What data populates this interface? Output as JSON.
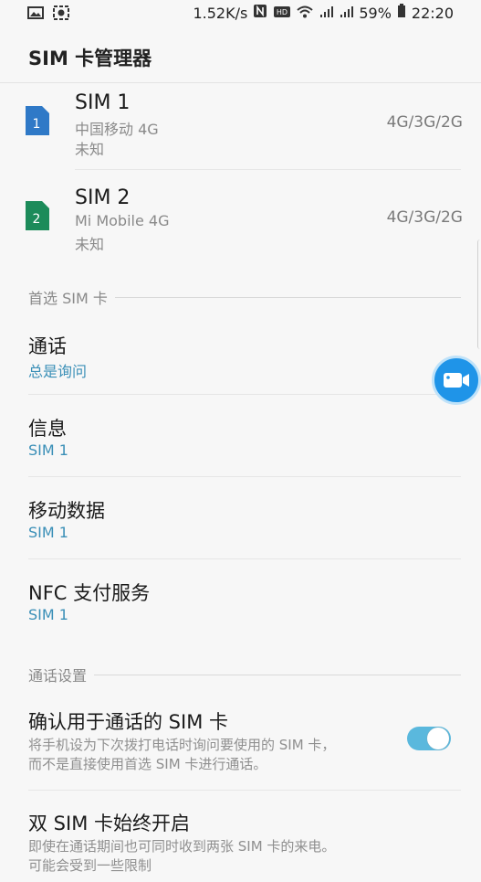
{
  "status_bar": {
    "left_icons": [
      "image-icon",
      "screen-record-icon"
    ],
    "speed": "1.52K/s",
    "icons": [
      "nfc-icon",
      "hd-icon",
      "wifi-icon",
      "signal-4g-icon",
      "signal-4g-icon"
    ],
    "battery": "59%",
    "time": "22:20"
  },
  "app_bar": {
    "title": "SIM 卡管理器"
  },
  "sims": [
    {
      "name": "SIM 1",
      "number_badge": "1",
      "carrier": "中国移动 4G",
      "status": "未知",
      "network": "4G/3G/2G",
      "color": "#2f79c7"
    },
    {
      "name": "SIM 2",
      "number_badge": "2",
      "carrier": "Mi Mobile 4G",
      "status": "未知",
      "network": "4G/3G/2G",
      "color": "#1c8b5a"
    }
  ],
  "preferred_sim": {
    "header": "首选 SIM 卡",
    "items": [
      {
        "title": "通话",
        "value": "总是询问"
      },
      {
        "title": "信息",
        "value": "SIM 1"
      },
      {
        "title": "移动数据",
        "value": "SIM 1"
      },
      {
        "title": "NFC 支付服务",
        "value": "SIM 1"
      }
    ]
  },
  "call_settings": {
    "header": "通话设置",
    "confirm_sim": {
      "title": "确认用于通话的 SIM 卡",
      "desc_line1": "将手机设为下次拨打电话时询问要使用的 SIM 卡，",
      "desc_line2": "而不是直接使用首选 SIM 卡进行通话。",
      "toggle_on": true
    },
    "dual_sim": {
      "title": "双 SIM 卡始终开启",
      "desc_line1": "即使在通话期间也可同时收到两张 SIM 卡的来电。",
      "desc_line2": "可能会受到一些限制"
    }
  },
  "colors": {
    "accent": "#3a8fb7",
    "toggle": "#5ab8dd",
    "fab": "#1f94e8"
  }
}
